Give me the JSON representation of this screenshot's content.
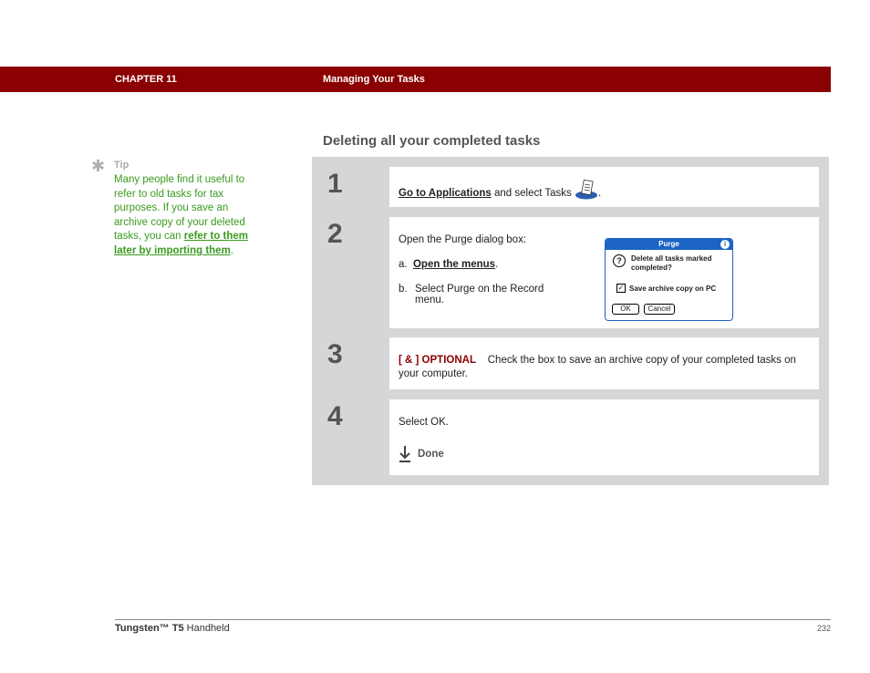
{
  "header": {
    "chapter": "CHAPTER 11",
    "title": "Managing Your Tasks"
  },
  "tip": {
    "label": "Tip",
    "text": "Many people find it useful to refer to old tasks for tax purposes. If you save an archive copy of your deleted tasks, you can",
    "link": "refer to them later by importing them",
    "end": "."
  },
  "section_title": "Deleting all your completed tasks",
  "steps": [
    {
      "num": "1",
      "link": "Go to Applications",
      "text": "and select Tasks",
      "end": "."
    },
    {
      "num": "2",
      "intro": "Open the Purge dialog box:",
      "a_label": "a.",
      "a_link": "Open the menus",
      "a_end": ".",
      "b_label": "b.",
      "b_text": "Select Purge on the Record menu."
    },
    {
      "num": "3",
      "optional": "[ & ]  OPTIONAL",
      "text": "Check the box to save an archive copy of your completed tasks on your computer."
    },
    {
      "num": "4",
      "text": "Select OK.",
      "done": "Done"
    }
  ],
  "dialog": {
    "title": "Purge",
    "message": "Delete all tasks marked completed?",
    "checkbox": "Save archive copy on PC",
    "ok": "OK",
    "cancel": "Cancel"
  },
  "footer": {
    "product": "Tungsten™ T5",
    "suffix": "Handheld",
    "page": "232"
  }
}
